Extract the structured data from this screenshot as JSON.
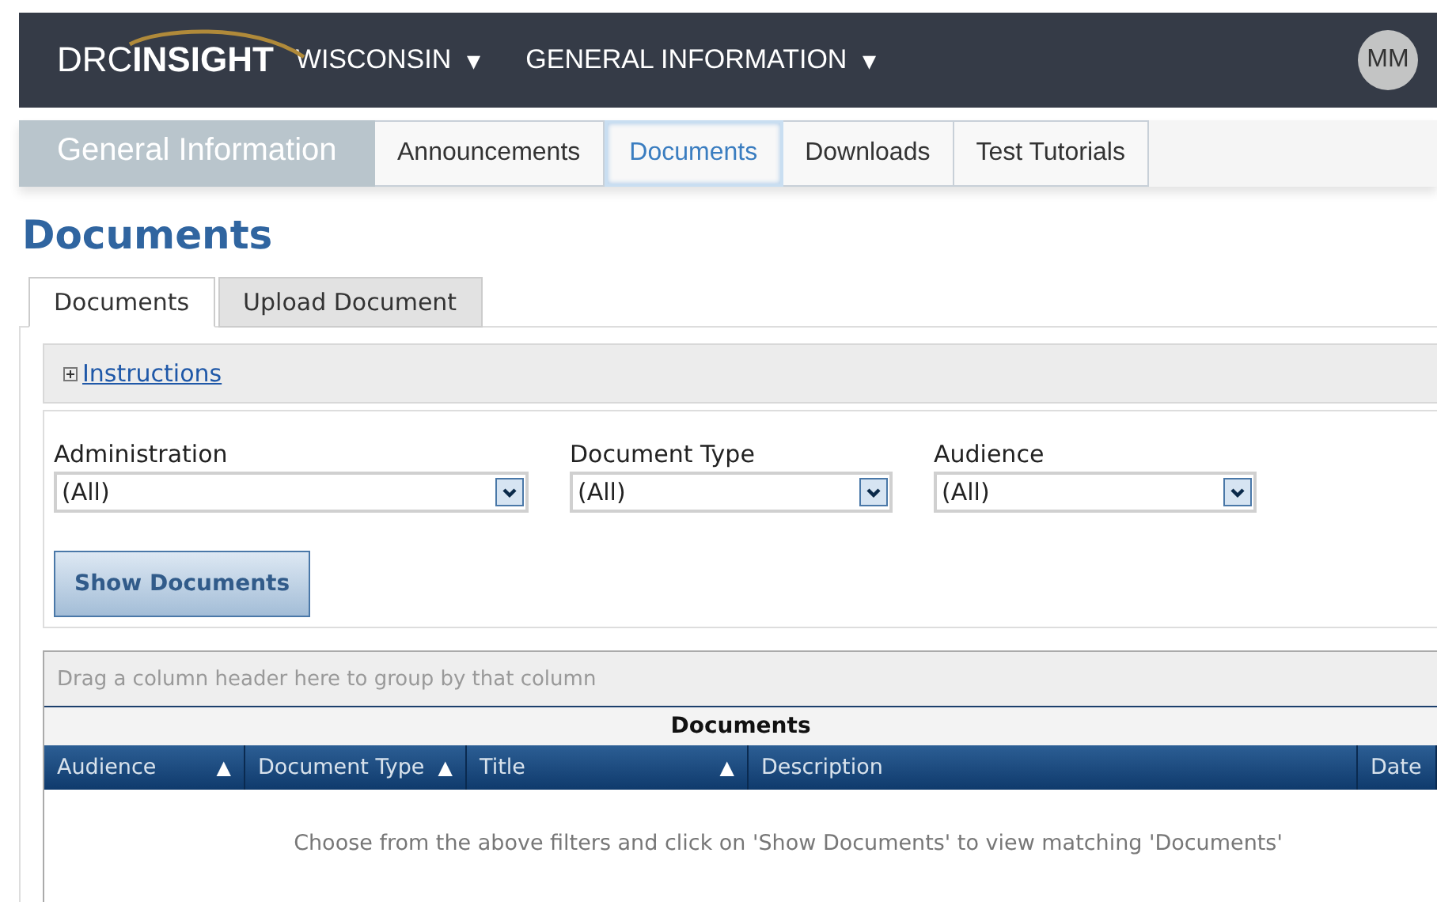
{
  "top_bar": {
    "logo": {
      "prefix": "DRC",
      "name": "INSIGHT"
    },
    "menus": [
      {
        "label": "WISCONSIN",
        "caret": "▾"
      },
      {
        "label": "GENERAL INFORMATION",
        "caret": "▾"
      }
    ],
    "avatar": "MM"
  },
  "sub_nav": {
    "title": "General Information",
    "tabs": [
      {
        "label": "Announcements",
        "selected": false
      },
      {
        "label": "Documents",
        "selected": true
      },
      {
        "label": "Downloads",
        "selected": false
      },
      {
        "label": "Test Tutorials",
        "selected": false
      }
    ]
  },
  "page_title": "Documents",
  "tabs": [
    {
      "label": "Documents",
      "selected": true
    },
    {
      "label": "Upload Document",
      "selected": false
    }
  ],
  "instructions": {
    "label": "Instructions",
    "expanded": false
  },
  "filters": [
    {
      "label": "Administration",
      "value": "(All)"
    },
    {
      "label": "Document Type",
      "value": "(All)"
    },
    {
      "label": "Audience",
      "value": "(All)"
    }
  ],
  "show_button": "Show Documents",
  "grid": {
    "group_hint": "Drag a column header here to group by that column",
    "caption": "Documents",
    "columns": [
      {
        "label": "Audience",
        "sort": "▲"
      },
      {
        "label": "Document Type",
        "sort": "▲"
      },
      {
        "label": "Title",
        "sort": "▲"
      },
      {
        "label": "Description"
      },
      {
        "label": "Date"
      }
    ],
    "empty_message": "Choose from the above filters and click on 'Show Documents' to view matching 'Documents'"
  }
}
